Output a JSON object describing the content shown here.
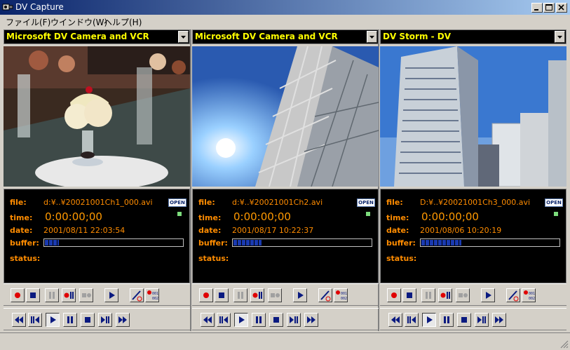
{
  "window": {
    "title": "DV Capture"
  },
  "menu": [
    "ファイル(F)",
    "ウインドウ(W)",
    "ヘルプ(H)"
  ],
  "labels": {
    "file": "file:",
    "time": "time:",
    "date": "date:",
    "buffer": "buffer:",
    "status": "status:",
    "open": "OPEN"
  },
  "panels": [
    {
      "source": "Microsoft DV Camera and VCR",
      "file": "d:¥..¥20021001Ch1_000.avi",
      "time": "0:00:00;00",
      "date": "2001/08/11  22:03:54",
      "buffer_fraction": 0.1,
      "status": ""
    },
    {
      "source": "Microsoft DV Camera and VCR",
      "file": "d:¥..¥20021001Ch2.avi",
      "time": "0:00:00;00",
      "date": "2001/08/17  10:22:37",
      "buffer_fraction": 0.2,
      "status": ""
    },
    {
      "source": "DV Storm - DV",
      "file": "D:¥..¥20021001Ch3_000.avi",
      "time": "0:00:00;00",
      "date": "2001/08/06  10:20:19",
      "buffer_fraction": 0.29,
      "status": ""
    }
  ],
  "colors": {
    "label_orange": "#ff8c00",
    "source_yellow": "#ffff00",
    "buffer_blue": "#1a3ab0",
    "titlebar": "#0a246a"
  }
}
